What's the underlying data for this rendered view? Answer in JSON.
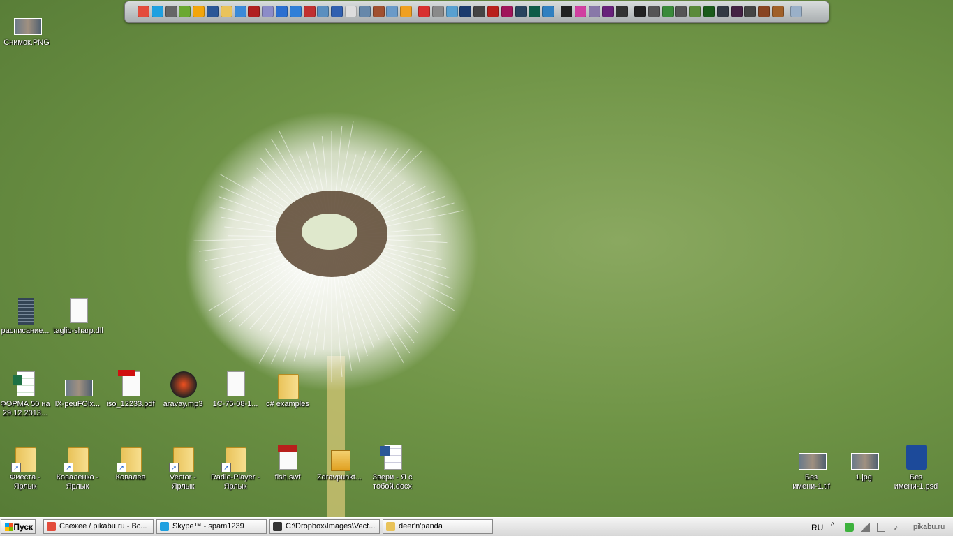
{
  "dock": {
    "icons": [
      {
        "name": "chrome-icon",
        "color": "#e34c3c"
      },
      {
        "name": "skype-icon",
        "color": "#1fa0e0"
      },
      {
        "name": "steam-like-icon",
        "color": "#666666"
      },
      {
        "name": "utorrent-icon",
        "color": "#6aa832"
      },
      {
        "name": "aimp-icon",
        "color": "#f2a50c"
      },
      {
        "name": "word-icon",
        "color": "#2b5797"
      },
      {
        "name": "folder-icon",
        "color": "#e9c35a"
      },
      {
        "name": "network-icon",
        "color": "#3a8ad8"
      },
      {
        "name": "film-icon",
        "color": "#b02020"
      },
      {
        "name": "save-icon",
        "color": "#8c8cc8"
      },
      {
        "name": "globe-icon",
        "color": "#2b6fd0"
      },
      {
        "name": "lightning-icon",
        "color": "#2f7fd8"
      },
      {
        "name": "64-icon",
        "color": "#c03030"
      },
      {
        "name": "usb-icon",
        "color": "#5a8fbf"
      },
      {
        "name": "virtualbox-icon",
        "color": "#3060b0"
      },
      {
        "name": "calculator-icon",
        "color": "#dddddd"
      },
      {
        "name": "m-icon",
        "color": "#6688aa"
      },
      {
        "name": "photo-icon",
        "color": "#a05030"
      },
      {
        "name": "camera-icon",
        "color": "#6a9ac8"
      },
      {
        "name": "z-icon",
        "color": "#f0a020"
      },
      {
        "name": "scribble-icon",
        "color": "#d83030"
      },
      {
        "name": "gear-icon",
        "color": "#8a8a8a"
      },
      {
        "name": "picasa-icon",
        "color": "#58a0d0"
      },
      {
        "name": "photoshop-icon",
        "color": "#1c3c6e"
      },
      {
        "name": "diamond-icon",
        "color": "#444444"
      },
      {
        "name": "flash-icon",
        "color": "#b8201c"
      },
      {
        "name": "indesign-icon",
        "color": "#a0155a"
      },
      {
        "name": "lightroom-icon",
        "color": "#29445e"
      },
      {
        "name": "audition-icon",
        "color": "#0e5c48"
      },
      {
        "name": "play-icon",
        "color": "#3080c0"
      },
      {
        "name": "silhouette-icon",
        "color": "#222222"
      },
      {
        "name": "pink-icon",
        "color": "#d040a0"
      },
      {
        "name": "disc-icon",
        "color": "#8878a8"
      },
      {
        "name": "visual-studio-icon",
        "color": "#68217a"
      },
      {
        "name": "unity-icon",
        "color": "#333333"
      },
      {
        "name": "dog-icon",
        "color": "#222222"
      },
      {
        "name": "skull-icon",
        "color": "#555555"
      },
      {
        "name": "chip-icon",
        "color": "#3a8a3a"
      },
      {
        "name": "skyrim-icon",
        "color": "#555555"
      },
      {
        "name": "minecraft-icon",
        "color": "#5a8a3a"
      },
      {
        "name": "matrix-icon",
        "color": "#1a5a1a"
      },
      {
        "name": "steam-icon",
        "color": "#333a44"
      },
      {
        "name": "music-icon",
        "color": "#442244"
      },
      {
        "name": "cs-icon",
        "color": "#444444"
      },
      {
        "name": "game-icon",
        "color": "#884422"
      },
      {
        "name": "game2-icon",
        "color": "#a06028"
      },
      {
        "name": "recycle-bin-icon",
        "color": "#9ab0c8"
      }
    ]
  },
  "desktop": {
    "top": [
      {
        "label": "Снимок.PNG",
        "icon": "image-thumb-icon"
      }
    ],
    "row1": [
      {
        "label": "расписание...",
        "icon": "spreadsheet-thumb-icon"
      },
      {
        "label": "taglib-sharp.dll",
        "icon": "dll-icon"
      }
    ],
    "row2": [
      {
        "label": "ФОРМА 50 на\n29.12.2013...",
        "icon": "excel-icon"
      },
      {
        "label": "lX-peuFOlx...",
        "icon": "photo-thumb-icon"
      },
      {
        "label": "iso_12233.pdf",
        "icon": "pdf-icon"
      },
      {
        "label": "aravay.mp3",
        "icon": "mp3-icon"
      },
      {
        "label": "1C-75-08-1...",
        "icon": "blank-file-icon"
      },
      {
        "label": "c# examples",
        "icon": "folder-icon"
      }
    ],
    "row3": [
      {
        "label": "Фиеста -\nЯрлык",
        "icon": "folder-shortcut-icon"
      },
      {
        "label": "Коваленко -\nЯрлык",
        "icon": "folder-shortcut-icon"
      },
      {
        "label": "Ковалев",
        "icon": "folder-shortcut-icon"
      },
      {
        "label": "Vector -\nЯрлык",
        "icon": "folder-shortcut-icon"
      },
      {
        "label": "Radio-Player -\nЯрлык",
        "icon": "folder-shortcut-icon"
      },
      {
        "label": "fish.swf",
        "icon": "swf-icon"
      },
      {
        "label": "Zdravpunkt...",
        "icon": "installer-icon"
      },
      {
        "label": "Звери - Я с\nтобой.docx",
        "icon": "word-doc-icon"
      }
    ],
    "right": [
      {
        "label": "Без\nимени-1.tif",
        "icon": "tif-thumb-icon"
      },
      {
        "label": "1.jpg",
        "icon": "jpg-thumb-icon"
      },
      {
        "label": "Без\nимени-1.psd",
        "icon": "psd-icon"
      }
    ]
  },
  "taskbar": {
    "start_label": "Пуск",
    "tasks": [
      {
        "label": "Свежее / pikabu.ru - Вс...",
        "icon": "chrome-icon",
        "color": "#e34c3c"
      },
      {
        "label": "Skype™ - spam1239",
        "icon": "skype-icon",
        "color": "#1fa0e0"
      },
      {
        "label": "C:\\Dropbox\\Images\\Vect...",
        "icon": "inkscape-icon",
        "color": "#333333"
      },
      {
        "label": "deer'n'panda",
        "icon": "folder-icon",
        "color": "#e9c35a"
      }
    ],
    "tray": {
      "language": "RU",
      "clock_text": "pikabu.ru"
    }
  }
}
